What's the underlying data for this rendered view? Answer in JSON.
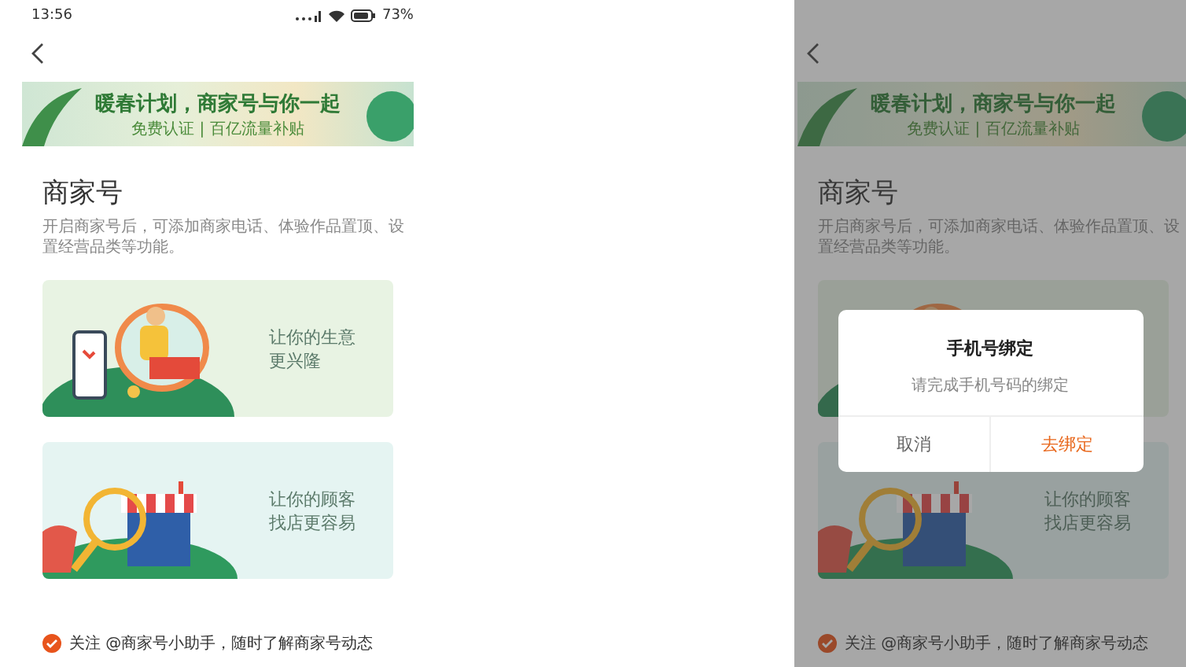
{
  "screens": [
    {
      "dimmed": false,
      "status_bar": {
        "time": "13:56",
        "battery": "73%"
      },
      "banner": {
        "title": "暖春计划，商家号与你一起",
        "subtitle": "免费认证 | 百亿流量补贴"
      },
      "heading": "商家号",
      "description": "开启商家号后，可添加商家电话、体验作品置顶、设置经营品类等功能。",
      "cards": [
        {
          "kind": "shop",
          "lines": [
            "让你的生意",
            "更兴隆"
          ],
          "color": "#e8f3e3"
        },
        {
          "kind": "search",
          "lines": [
            "让你的顾客",
            "找店更容易"
          ],
          "color": "#e5f4f2"
        }
      ],
      "follow": {
        "checked": true,
        "text": "关注 @商家号小助手，随时了解商家号动态"
      }
    },
    {
      "dimmed": true,
      "banner": {
        "title": "暖春计划，商家号与你一起",
        "subtitle": "免费认证 | 百亿流量补贴"
      },
      "heading": "商家号",
      "description": "开启商家号后，可添加商家电话、体验作品置顶、设置经营品类等功能。",
      "cards": [
        {
          "kind": "shop",
          "color": "#e8f3e3"
        },
        {
          "kind": "search",
          "lines": [
            "让你的顾客",
            "找店更容易"
          ],
          "color": "#e5f4f2"
        }
      ],
      "follow": {
        "checked": true,
        "text": "关注 @商家号小助手，随时了解商家号动态"
      },
      "dialog": {
        "title": "手机号绑定",
        "message": "请完成手机号码的绑定",
        "buttons": [
          {
            "kind": "cancel",
            "label": "取消"
          },
          {
            "kind": "confirm",
            "label": "去绑定"
          }
        ]
      }
    }
  ]
}
